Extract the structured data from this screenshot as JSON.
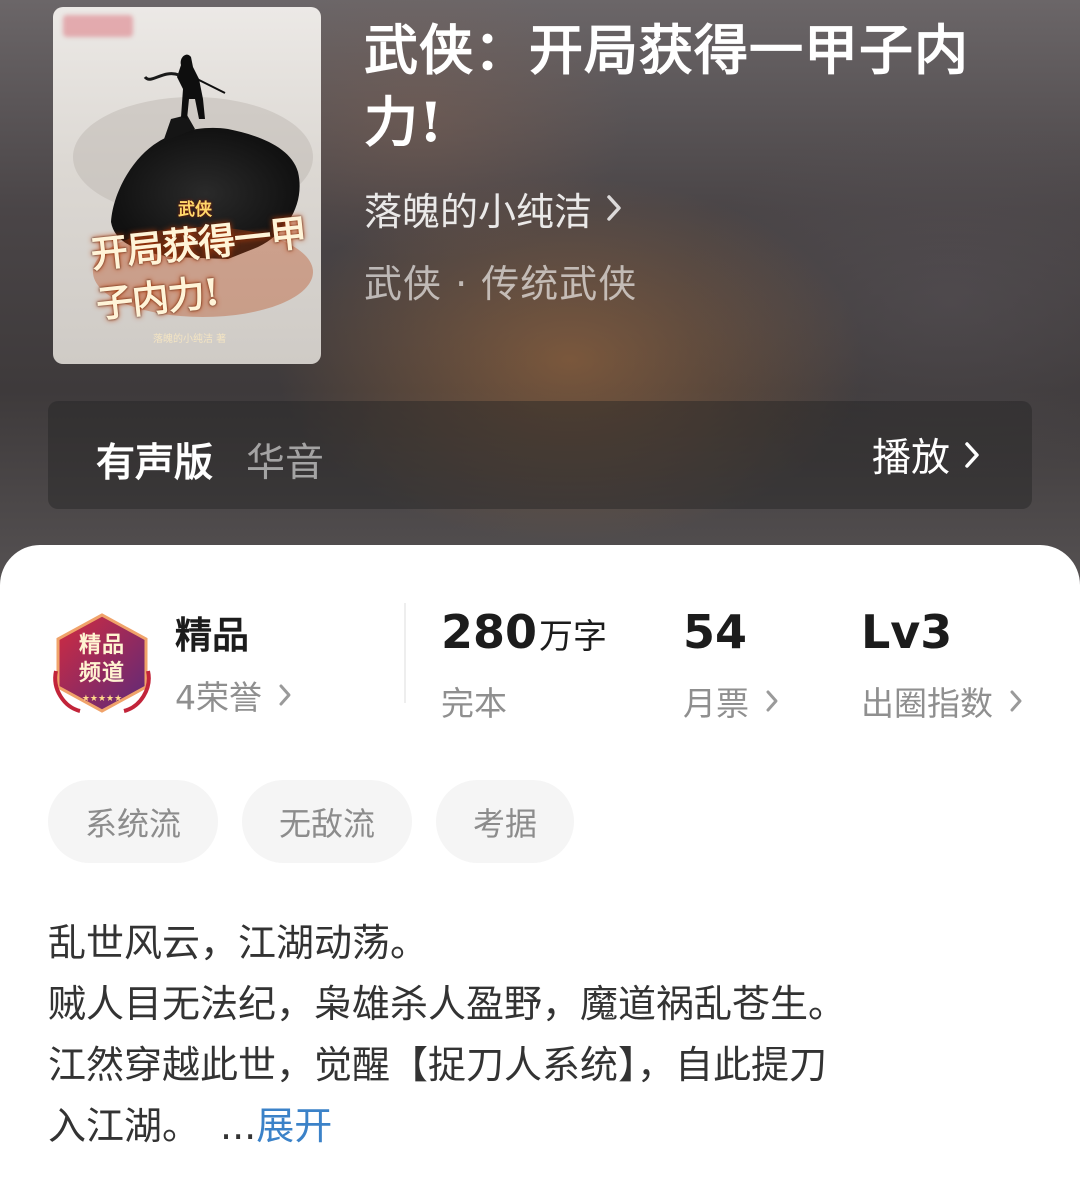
{
  "colors": {
    "header_bg": "#4a4547",
    "card_bg": "#ffffff",
    "link_blue": "#3b82c8",
    "badge_red": "#b5233a",
    "badge_purple": "#5b2a7a"
  },
  "cover": {
    "genre_tag": "武侠",
    "title_art": "开局获得一甲子内力!",
    "author_small": "落魄的小纯洁 著"
  },
  "book": {
    "title": "武侠：开局获得一甲子内力!",
    "author": "落魄的小纯洁",
    "author_chevron_icon": "chevron-right-icon",
    "genre": "武侠 · 传统武侠"
  },
  "audio": {
    "label": "有声版",
    "voice": "华音",
    "play_label": "播放",
    "play_chevron_icon": "chevron-right-icon"
  },
  "stats": {
    "badge_text_line1": "精品",
    "badge_text_line2": "频道",
    "badge_icon": "premium-channel-badge-icon",
    "quality_title": "精品",
    "honors": "4荣誉",
    "word_count": "280",
    "word_unit": "万字",
    "status": "完本",
    "monthly_tickets": "54",
    "monthly_tickets_label": "月票",
    "circle_index": "Lv3",
    "circle_index_label": "出圈指数"
  },
  "tags": [
    "系统流",
    "无敌流",
    "考据"
  ],
  "description": {
    "lines": [
      "乱世风云，江湖动荡。",
      "贼人目无法纪，枭雄杀人盈野，魔道祸乱苍生。",
      "江然穿越此世，觉醒【捉刀人系统】，自此提刀",
      "入江湖。"
    ],
    "ellipsis": "...",
    "expand_label": "展开"
  }
}
